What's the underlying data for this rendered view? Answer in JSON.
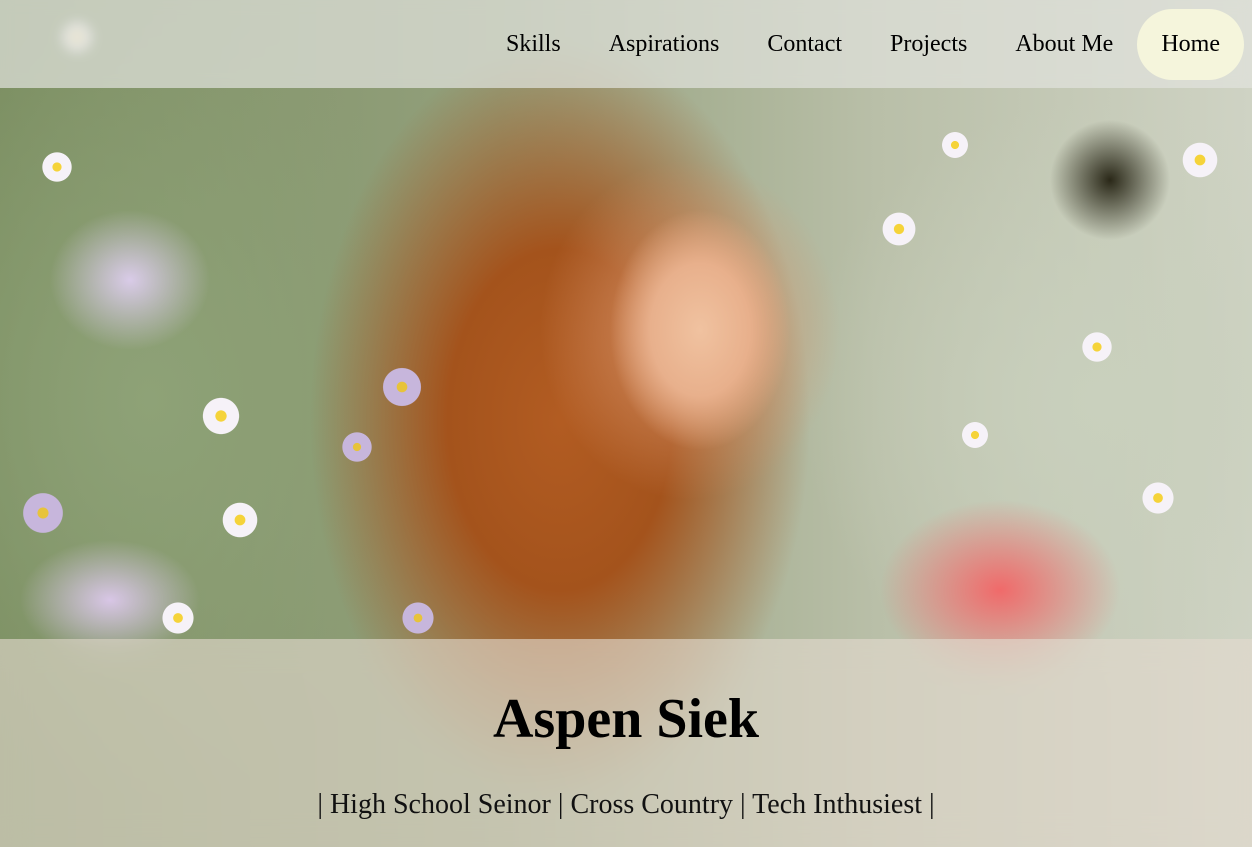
{
  "nav": {
    "items": [
      {
        "label": "Skills"
      },
      {
        "label": "Aspirations"
      },
      {
        "label": "Contact"
      },
      {
        "label": "Projects"
      },
      {
        "label": "About Me"
      },
      {
        "label": "Home",
        "active": true
      }
    ]
  },
  "hero": {
    "name": "Aspen Siek",
    "tagline": "| High School Seinor | Cross Country | Tech Inthusiest |"
  },
  "colors": {
    "active_nav_bg": "#f5f5dc",
    "text": "#000000"
  }
}
